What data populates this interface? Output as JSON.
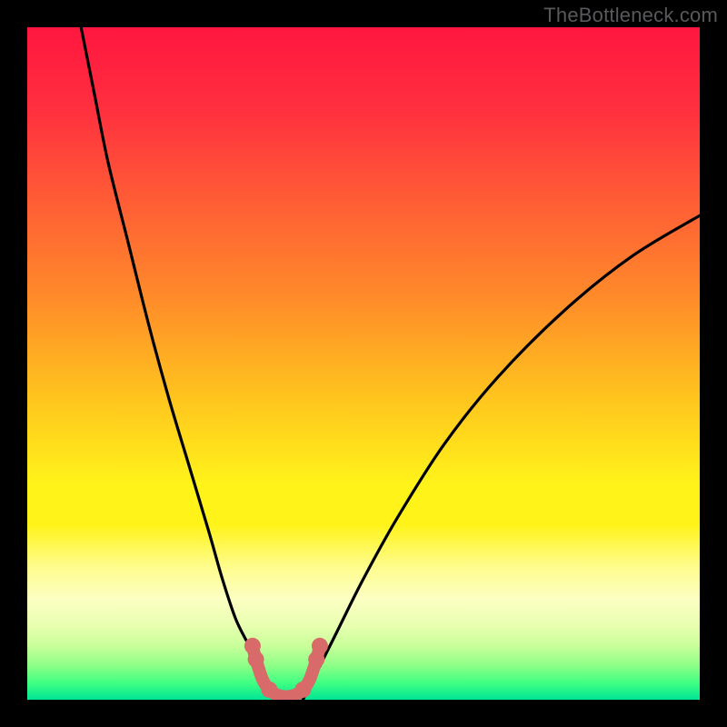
{
  "attribution": "TheBottleneck.com",
  "chart_data": {
    "type": "line",
    "title": "",
    "xlabel": "",
    "ylabel": "",
    "xlim": [
      0,
      100
    ],
    "ylim": [
      0,
      100
    ],
    "series": [
      {
        "name": "left-curve",
        "x": [
          8,
          10,
          12,
          15,
          18,
          21,
          24,
          27,
          29,
          31,
          33,
          35,
          36,
          37
        ],
        "values": [
          100,
          90,
          80,
          68,
          56,
          45,
          35,
          25,
          18,
          12,
          8,
          4,
          2,
          0
        ]
      },
      {
        "name": "right-curve",
        "x": [
          41,
          43,
          46,
          50,
          55,
          62,
          70,
          80,
          90,
          100
        ],
        "values": [
          0,
          4,
          10,
          18,
          27,
          38,
          48,
          58,
          66,
          72
        ]
      }
    ],
    "valley_marker": {
      "points": [
        {
          "x": 33.5,
          "y": 8
        },
        {
          "x": 34,
          "y": 6
        },
        {
          "x": 35,
          "y": 3
        },
        {
          "x": 36,
          "y": 1.5
        },
        {
          "x": 37,
          "y": 0.8
        },
        {
          "x": 38,
          "y": 0.5
        },
        {
          "x": 39,
          "y": 0.5
        },
        {
          "x": 40,
          "y": 0.8
        },
        {
          "x": 41,
          "y": 1.5
        },
        {
          "x": 42,
          "y": 3
        },
        {
          "x": 43,
          "y": 6
        },
        {
          "x": 43.5,
          "y": 8
        }
      ],
      "color": "#d86a6a"
    },
    "background_gradient_stops": [
      {
        "offset": 0.0,
        "color": "#ff163f"
      },
      {
        "offset": 0.12,
        "color": "#ff2f3f"
      },
      {
        "offset": 0.25,
        "color": "#ff5a36"
      },
      {
        "offset": 0.4,
        "color": "#ff8a2a"
      },
      {
        "offset": 0.55,
        "color": "#ffc41e"
      },
      {
        "offset": 0.68,
        "color": "#fff31a"
      },
      {
        "offset": 0.74,
        "color": "#fff31a"
      },
      {
        "offset": 0.8,
        "color": "#fffc8a"
      },
      {
        "offset": 0.85,
        "color": "#fcffc2"
      },
      {
        "offset": 0.89,
        "color": "#e8ffb0"
      },
      {
        "offset": 0.92,
        "color": "#c9ff9a"
      },
      {
        "offset": 0.95,
        "color": "#8cff86"
      },
      {
        "offset": 0.975,
        "color": "#3fff82"
      },
      {
        "offset": 1.0,
        "color": "#00e596"
      }
    ]
  }
}
